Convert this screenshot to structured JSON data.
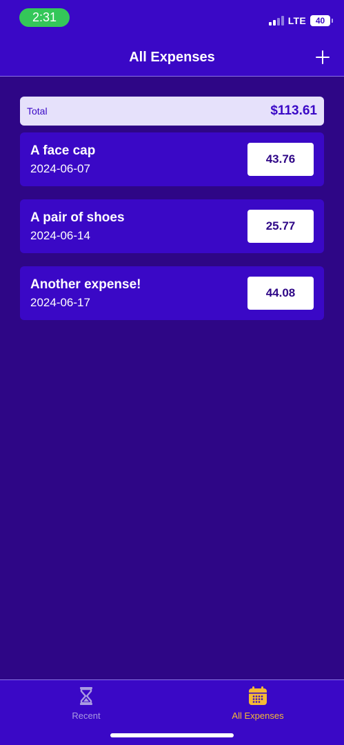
{
  "status_bar": {
    "time": "2:31",
    "network": "LTE",
    "battery": "40"
  },
  "header": {
    "title": "All Expenses",
    "add_icon": "plus-icon"
  },
  "total": {
    "label": "Total",
    "value": "$113.61"
  },
  "expenses": [
    {
      "title": "A face cap",
      "date": "2024-06-07",
      "amount": "43.76"
    },
    {
      "title": "A pair of shoes",
      "date": "2024-06-14",
      "amount": "25.77"
    },
    {
      "title": "Another expense!",
      "date": "2024-06-17",
      "amount": "44.08"
    }
  ],
  "tabs": [
    {
      "label": "Recent",
      "icon": "hourglass-icon",
      "active": false
    },
    {
      "label": "All Expenses",
      "icon": "calendar-icon",
      "active": true
    }
  ],
  "colors": {
    "background": "#2e0686",
    "header": "#3a08c6",
    "card": "#3a08c6",
    "total_bar": "#e6e1fb",
    "active_tab": "#f5b935",
    "inactive_tab": "#a99ae2",
    "time_pill": "#34c759"
  }
}
